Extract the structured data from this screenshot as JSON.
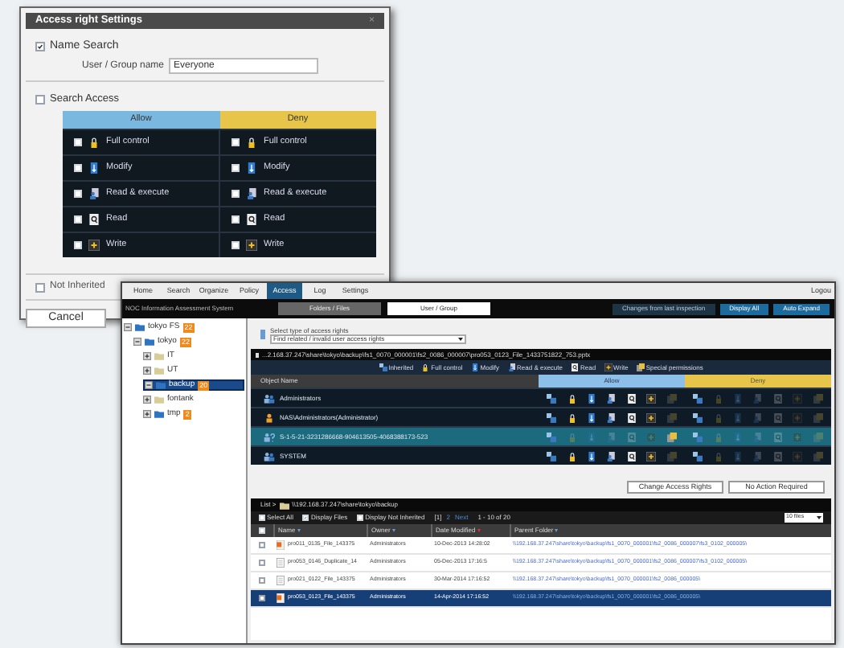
{
  "dialog": {
    "title": "Access right Settings",
    "close": "×",
    "name_search": {
      "label": "Name Search",
      "checked": true,
      "field_label": "User / Group name",
      "value": "Everyone"
    },
    "search_access": {
      "label": "Search Access",
      "checked": false
    },
    "columns": [
      {
        "label": "Allow",
        "color": "#7ab8e0"
      },
      {
        "label": "Deny",
        "color": "#e6c54a"
      }
    ],
    "rights": [
      {
        "kind": "full_control",
        "allow": {
          "label": "Full control",
          "checked": false
        },
        "deny": {
          "label": "Full control",
          "checked": false
        }
      },
      {
        "kind": "modify",
        "allow": {
          "label": "Modify",
          "checked": false
        },
        "deny": {
          "label": "Modify",
          "checked": false
        }
      },
      {
        "kind": "read_execute",
        "allow": {
          "label": "Read & execute",
          "checked": false
        },
        "deny": {
          "label": "Read & execute",
          "checked": false
        }
      },
      {
        "kind": "read",
        "allow": {
          "label": "Read",
          "checked": false
        },
        "deny": {
          "label": "Read",
          "checked": false
        }
      },
      {
        "kind": "write",
        "allow": {
          "label": "Write",
          "checked": false
        },
        "deny": {
          "label": "Write",
          "checked": false
        }
      }
    ],
    "not_inherited": {
      "label": "Not Inherited",
      "checked": false
    },
    "buttons": [
      "Cancel"
    ]
  },
  "app": {
    "menu": [
      {
        "label": "Home",
        "selected": false
      },
      {
        "label": "Search",
        "selected": false
      },
      {
        "label": "Organize",
        "selected": false
      },
      {
        "label": "Policy",
        "selected": false
      },
      {
        "label": "Access",
        "selected": true
      },
      {
        "label": "Log",
        "selected": false
      },
      {
        "label": "Settings",
        "selected": false
      }
    ],
    "logout": "Logou",
    "system_name": "NOC Information Assessment System",
    "view_tabs": [
      {
        "label": "Folders / Files",
        "selected": false
      },
      {
        "label": "User / Group",
        "selected": true
      }
    ],
    "changes_label": "Changes from last inspection",
    "actions": [
      "Display All",
      "Auto Expand"
    ],
    "tree": [
      {
        "label": "tokyo FS",
        "badge": "22",
        "expanded": true,
        "selected": false,
        "children": [
          {
            "label": "tokyo",
            "badge": "22",
            "expanded": true,
            "selected": false,
            "children": [
              {
                "label": "IT",
                "expanded": false,
                "selected": false
              },
              {
                "label": "UT",
                "expanded": false,
                "selected": false
              },
              {
                "label": "backup",
                "badge": "20",
                "expanded": true,
                "selected": true
              },
              {
                "label": "fontank",
                "expanded": false,
                "selected": false
              },
              {
                "label": "tmp",
                "badge": "2",
                "expanded": false,
                "selected": false
              }
            ]
          }
        ]
      }
    ],
    "access_type": {
      "label": "Select type of access rights",
      "value": "Find related / invalid user access rights"
    },
    "path": "...2.168.37.247\\share\\tokyo\\backup\\fs1_0070_000001\\fs2_0086_000007\\pro053_0123_File_1433751822_753.pptx",
    "legend": [
      {
        "kind": "inherited",
        "label": "Inherited"
      },
      {
        "kind": "full_control",
        "label": "Full control"
      },
      {
        "kind": "modify",
        "label": "Modify"
      },
      {
        "kind": "read_execute",
        "label": "Read & execute"
      },
      {
        "kind": "read",
        "label": "Read"
      },
      {
        "kind": "write",
        "label": "Write"
      },
      {
        "kind": "special",
        "label": "Special permissions"
      }
    ],
    "objects": {
      "columns": [
        "Object Name",
        "Allow",
        "Deny"
      ],
      "rows": [
        {
          "kind": "group",
          "name": "Administrators",
          "selected": false,
          "allow": [
            true,
            true,
            true,
            true,
            true,
            true,
            false
          ],
          "deny": [
            true,
            false,
            false,
            false,
            false,
            false,
            false
          ]
        },
        {
          "kind": "user",
          "name": "NAS\\Administrators(Administrator)",
          "selected": false,
          "allow": [
            true,
            true,
            true,
            true,
            true,
            true,
            false
          ],
          "deny": [
            true,
            false,
            false,
            false,
            false,
            false,
            false
          ]
        },
        {
          "kind": "unknown",
          "name": "S-1-5-21-3231286668-904613505-4068388173-523",
          "selected": true,
          "allow": [
            true,
            false,
            false,
            false,
            false,
            false,
            true
          ],
          "deny": [
            true,
            false,
            false,
            false,
            false,
            false,
            false
          ]
        },
        {
          "kind": "group",
          "name": "SYSTEM",
          "selected": false,
          "allow": [
            true,
            true,
            true,
            true,
            true,
            true,
            false
          ],
          "deny": [
            true,
            false,
            false,
            false,
            false,
            false,
            false
          ]
        }
      ]
    },
    "object_buttons": [
      "Change Access Rights",
      "No Action Required"
    ],
    "list": {
      "crumb": "List >",
      "path": "\\\\192.168.37.247\\share\\tokyo\\backup",
      "options": [
        {
          "label": "Select All",
          "checked": false
        },
        {
          "label": "Display Files",
          "checked": true
        },
        {
          "label": "Display Not Inherited",
          "checked": false
        }
      ],
      "pages": [
        {
          "label": "[1]",
          "selected": true
        },
        {
          "label": "2",
          "selected": false
        }
      ],
      "header_checked": false,
      "next": "Next",
      "range": "1 - 10 of 20",
      "per_page": "10 files",
      "columns": [
        {
          "label": "Name",
          "sorted": false
        },
        {
          "label": "Owner",
          "sorted": false
        },
        {
          "label": "Date Modified",
          "sorted": true
        },
        {
          "label": "Parent Folder",
          "sorted": false
        }
      ],
      "rows": [
        {
          "kind": "presentation",
          "name": "pro011_0135_File_143375",
          "owner": "Administrators",
          "date": "10-Dec-2013 14:28:02",
          "parent": "\\\\192.168.37.247\\share\\tokyo\\backup\\fs1_0070_000001\\fs2_0086_000007\\fs3_0102_000005\\",
          "checked": false,
          "selected": false
        },
        {
          "kind": "document",
          "name": "pro053_0146_Duplicate_14",
          "owner": "Administrators",
          "date": "05-Dec-2013 17:16:5",
          "parent": "\\\\192.168.37.247\\share\\tokyo\\backup\\fs1_0070_000001\\fs2_0086_000007\\fs3_0102_000005\\",
          "checked": false,
          "selected": false
        },
        {
          "kind": "document",
          "name": "pro021_0122_File_143375",
          "owner": "Administrators",
          "date": "30-Mar-2014 17:16:52",
          "parent": "\\\\192.168.37.247\\share\\tokyo\\backup\\fs1_0070_000001\\fs2_0086_000005\\",
          "checked": false,
          "selected": false
        },
        {
          "kind": "presentation",
          "name": "pro053_0123_File_143375",
          "owner": "Administrators",
          "date": "14-Apr-2014 17:16:52",
          "parent": "\\\\192.168.37.247\\share\\tokyo\\backup\\fs1_0070_000001\\fs2_0086_000005\\",
          "checked": false,
          "selected": true
        }
      ]
    }
  }
}
